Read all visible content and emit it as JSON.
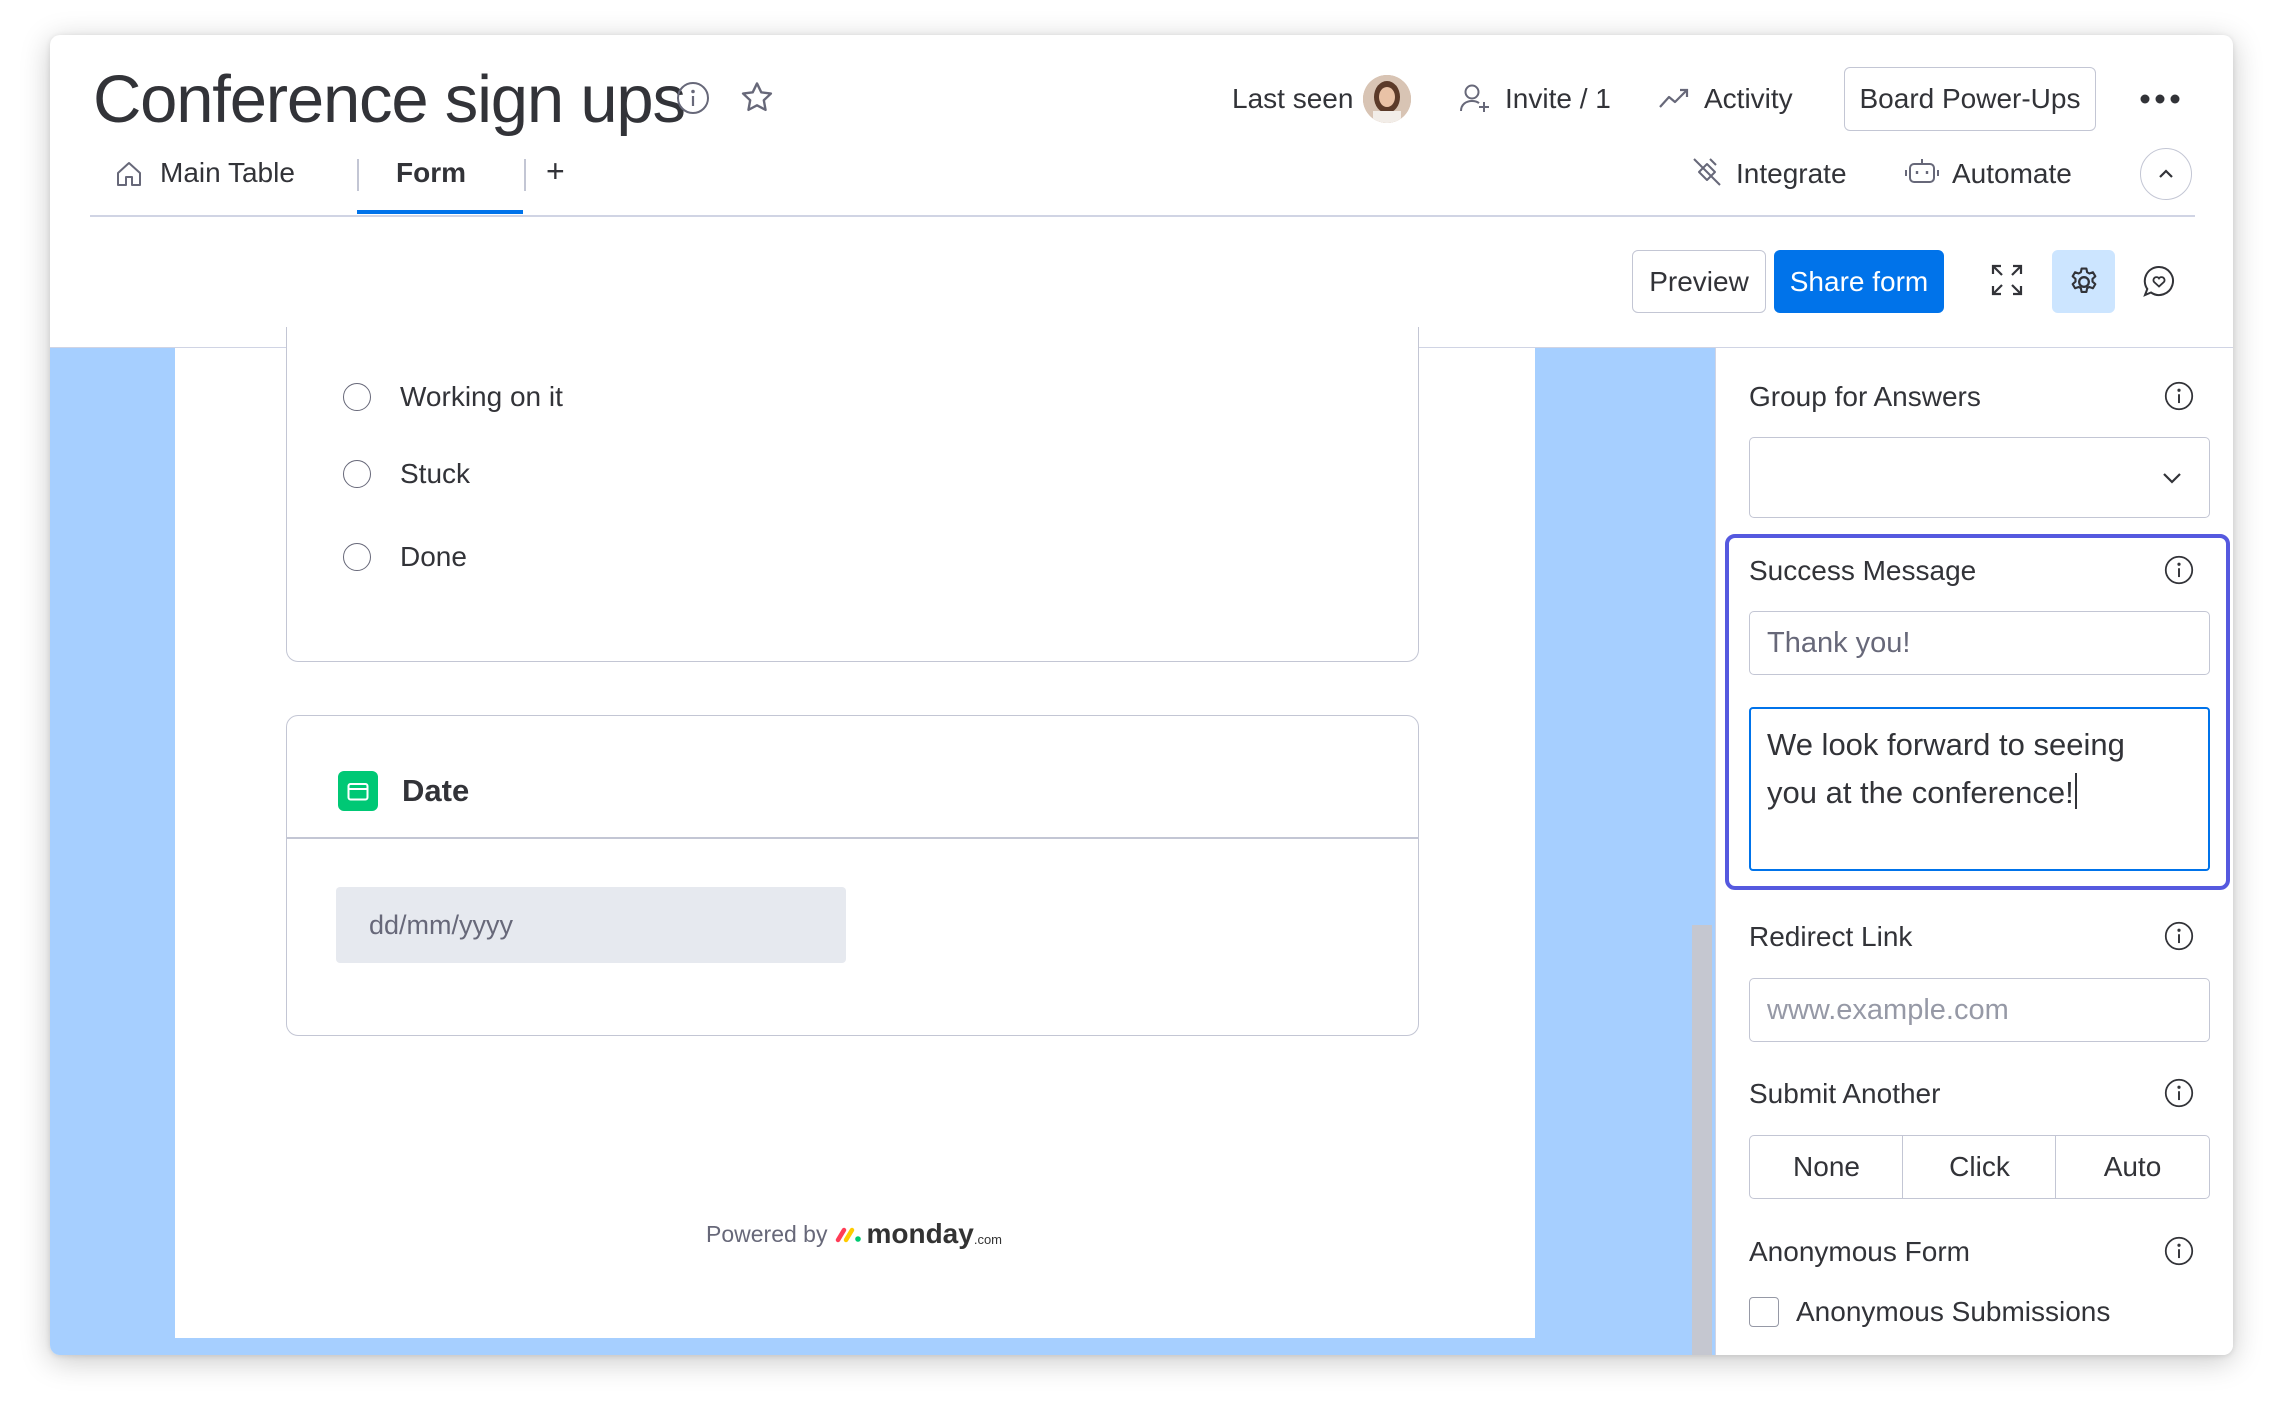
{
  "header": {
    "title": "Conference sign ups",
    "last_seen_label": "Last seen",
    "invite_label": "Invite / 1",
    "activity_label": "Activity",
    "power_ups_label": "Board Power-Ups",
    "icons": [
      "info-icon",
      "star-icon",
      "person-add-icon",
      "activity-trend-icon",
      "more-dots-icon"
    ]
  },
  "tabs": [
    {
      "label": "Main Table",
      "icon": "home-icon",
      "active": false
    },
    {
      "label": "Form",
      "active": true
    }
  ],
  "add_tab_label": "+",
  "integrations": {
    "integrate_label": "Integrate",
    "automate_label": "Automate"
  },
  "toolbar": {
    "preview_label": "Preview",
    "share_label": "Share form",
    "icons": [
      "expand-icon",
      "gear-icon",
      "feedback-icon"
    ]
  },
  "form": {
    "status_options": [
      "Working on it",
      "Stuck",
      "Done"
    ],
    "date_question": {
      "title": "Date",
      "placeholder": "dd/mm/yyyy"
    },
    "footer": {
      "powered_by": "Powered by",
      "brand": "monday",
      "brand_suffix": ".com"
    }
  },
  "settings": {
    "group_for_answers": {
      "label": "Group for Answers",
      "value": ""
    },
    "success_message": {
      "label": "Success Message",
      "title_value": "Thank you!",
      "message_line1": "We look forward to seeing",
      "message_line2": "you at the conference!"
    },
    "redirect_link": {
      "label": "Redirect Link",
      "placeholder": "www.example.com"
    },
    "submit_another": {
      "label": "Submit Another",
      "options": [
        "None",
        "Click",
        "Auto"
      ]
    },
    "anonymous_form": {
      "label": "Anonymous Form",
      "checkbox_label": "Anonymous Submissions",
      "checked": false
    }
  },
  "colors": {
    "primary": "#0073ea",
    "canvas_background": "#a6cfff",
    "highlight_border": "#5559df",
    "date_column_color": "#00c875",
    "settings_active_bg": "#cce5ff"
  }
}
